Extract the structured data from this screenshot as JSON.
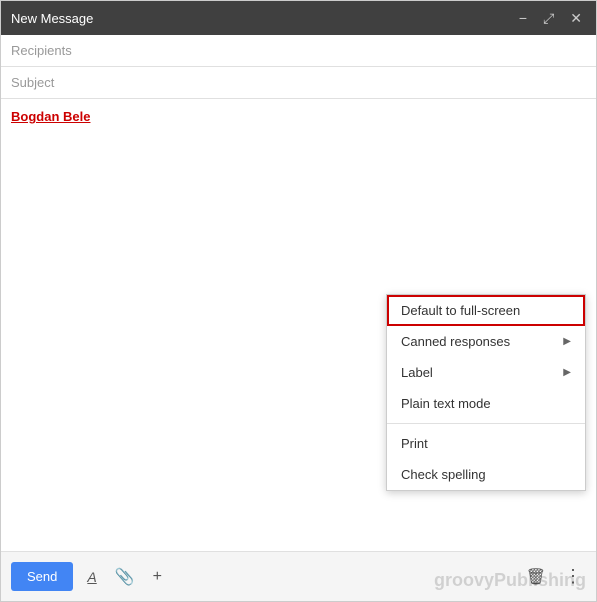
{
  "window": {
    "title": "New Message"
  },
  "controls": {
    "minimize": "−",
    "expand": "⤢",
    "close": "✕"
  },
  "fields": {
    "recipients_placeholder": "Recipients",
    "subject_placeholder": "Subject"
  },
  "body": {
    "text": "Bogdan Bele"
  },
  "toolbar": {
    "send_label": "Send",
    "format_icon": "A",
    "attach_icon": "📎",
    "more_icon": "+"
  },
  "dropdown": {
    "items": [
      {
        "id": "full-screen",
        "label": "Default to full-screen",
        "highlighted": true,
        "has_arrow": false
      },
      {
        "id": "canned-responses",
        "label": "Canned responses",
        "highlighted": false,
        "has_arrow": true
      },
      {
        "id": "label",
        "label": "Label",
        "highlighted": false,
        "has_arrow": true
      },
      {
        "id": "plain-text",
        "label": "Plain text mode",
        "highlighted": false,
        "has_arrow": false
      },
      {
        "id": "divider",
        "label": "",
        "is_divider": true
      },
      {
        "id": "print",
        "label": "Print",
        "highlighted": false,
        "has_arrow": false
      },
      {
        "id": "check-spelling",
        "label": "Check spelling",
        "highlighted": false,
        "has_arrow": false
      }
    ]
  },
  "watermark": {
    "text": "groovyPublishing"
  }
}
